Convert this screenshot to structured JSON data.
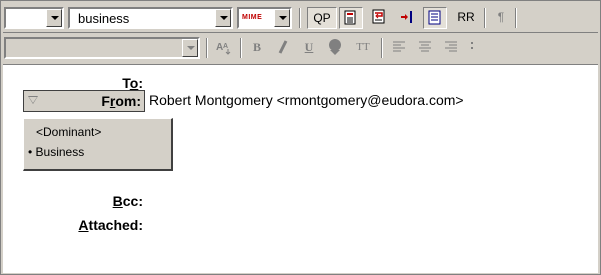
{
  "toolbar1": {
    "signature_value": "",
    "personality_value": "business",
    "mime_label": "MIME",
    "qp_label": "QP",
    "rr_label": "RR",
    "pilcrow_label": "¶"
  },
  "toolbar2": {
    "style_value": "",
    "tt_label": "TT"
  },
  "header": {
    "to_label": "To:",
    "to_value": "",
    "from_label": "From:",
    "from_value": "Robert Montgomery <rmontgomery@eudora.com>",
    "bcc_label": "Bcc:",
    "attached_label": "Attached:"
  },
  "personality_menu": {
    "items": [
      {
        "label": "<Dominant>",
        "selected": false
      },
      {
        "label": "• Business",
        "selected": true
      }
    ]
  },
  "colors": {
    "chrome": "#d4d0c8",
    "mime_red": "#c00000",
    "icon_red": "#c00000",
    "icon_blue": "#000080"
  }
}
